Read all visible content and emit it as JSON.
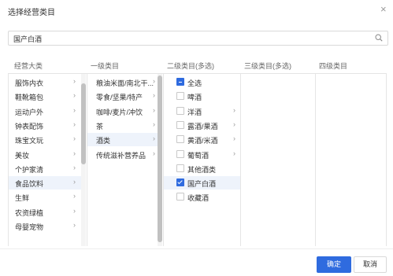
{
  "dialog": {
    "title": "选择经营类目",
    "close_symbol": "×"
  },
  "search": {
    "value": "国产白酒"
  },
  "columns": {
    "h1": "经营大类",
    "h2": "一级类目",
    "h3": "二级类目(多选)",
    "h4": "三级类目(多选)",
    "h5": "四级类目"
  },
  "col1": [
    {
      "label": "服饰内衣",
      "arrow": "›"
    },
    {
      "label": "鞋靴箱包",
      "arrow": "›"
    },
    {
      "label": "运动户外",
      "arrow": "›"
    },
    {
      "label": "钟表配饰",
      "arrow": "›"
    },
    {
      "label": "珠宝文玩",
      "arrow": "›"
    },
    {
      "label": "美妆",
      "arrow": "›"
    },
    {
      "label": "个护家清",
      "arrow": "›"
    },
    {
      "label": "食品饮料",
      "arrow": "›",
      "selected": true
    },
    {
      "label": "生鲜",
      "arrow": "›"
    },
    {
      "label": "农资绿植",
      "arrow": "›"
    },
    {
      "label": "母婴宠物",
      "arrow": "›"
    },
    {
      "label": "",
      "arrow": ""
    }
  ],
  "col2": [
    {
      "label": "粮油米面/南北干...",
      "arrow": "›"
    },
    {
      "label": "零食/坚果/特产",
      "arrow": "›"
    },
    {
      "label": "咖啡/麦片/冲饮",
      "arrow": "›"
    },
    {
      "label": "茶",
      "arrow": "›"
    },
    {
      "label": "酒类",
      "arrow": "›",
      "selected": true
    },
    {
      "label": "传统滋补营养品",
      "arrow": "›"
    }
  ],
  "col3": [
    {
      "label": "全选",
      "state": "indeterminate",
      "arrow": ""
    },
    {
      "label": "啤酒",
      "state": "unchecked",
      "arrow": ""
    },
    {
      "label": "洋酒",
      "state": "unchecked",
      "arrow": "›"
    },
    {
      "label": "露酒/果酒",
      "state": "unchecked",
      "arrow": "›"
    },
    {
      "label": "黄酒/米酒",
      "state": "unchecked",
      "arrow": "›"
    },
    {
      "label": "葡萄酒",
      "state": "unchecked",
      "arrow": "›"
    },
    {
      "label": "其他酒类",
      "state": "unchecked",
      "arrow": ""
    },
    {
      "label": "国产白酒",
      "state": "checked",
      "arrow": "",
      "selected": true
    },
    {
      "label": "收藏酒",
      "state": "unchecked",
      "arrow": ""
    }
  ],
  "buttons": {
    "confirm": "确定",
    "cancel": "取消"
  },
  "colors": {
    "primary": "#2f6bdf",
    "selected_bg": "#eef3fb"
  }
}
